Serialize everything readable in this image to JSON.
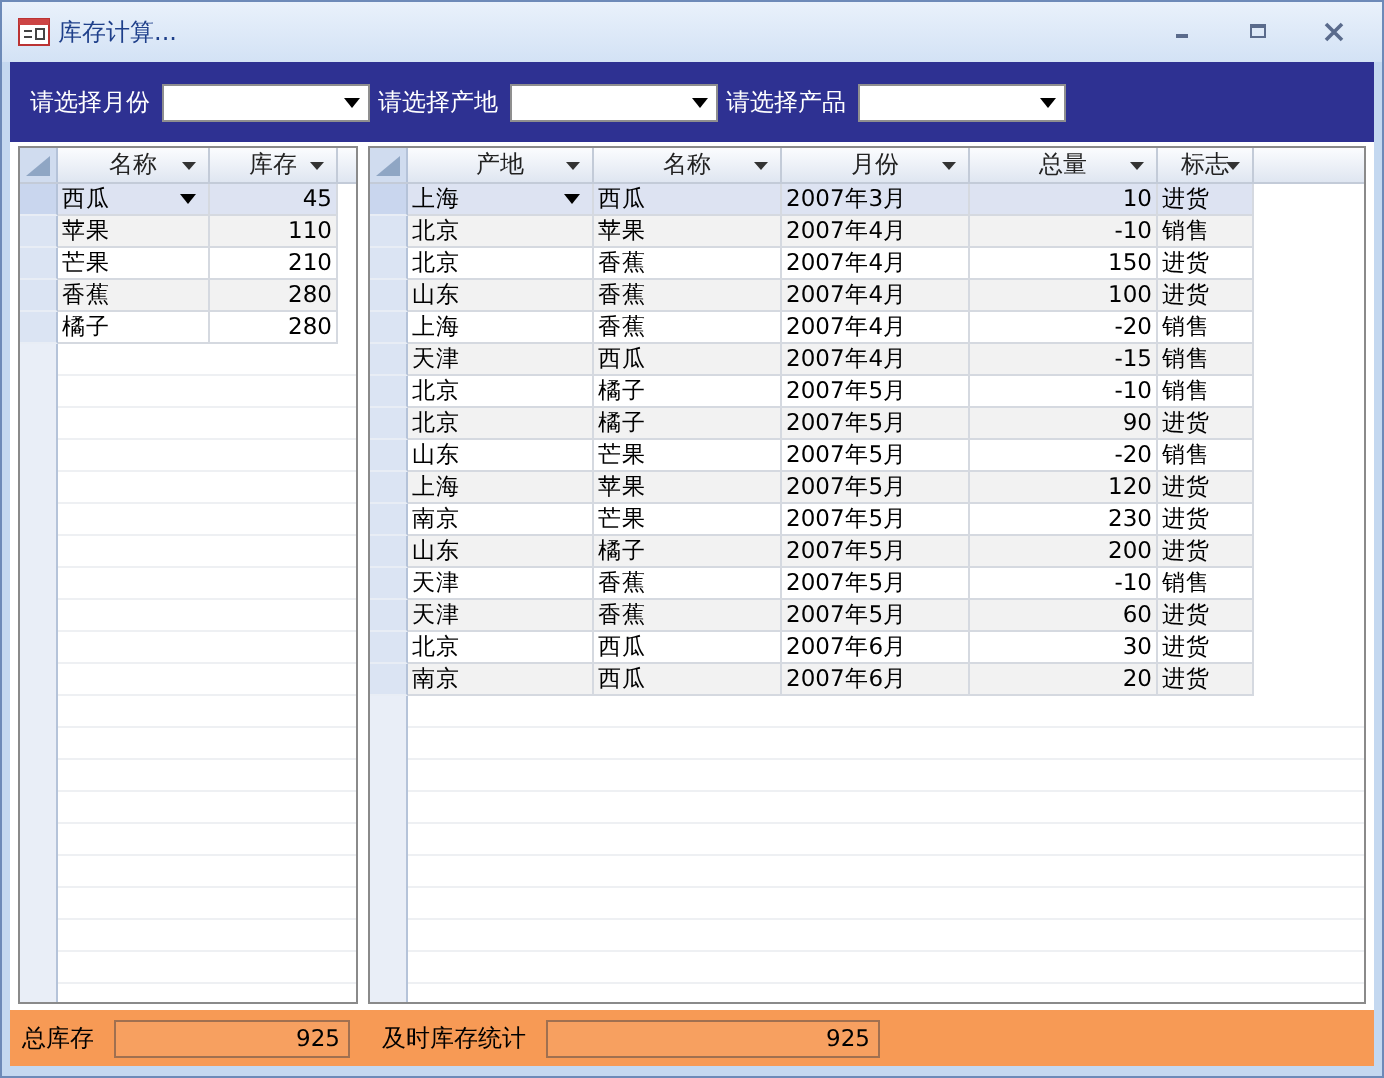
{
  "window": {
    "title": "库存计算..."
  },
  "filters": [
    {
      "label": "请选择月份"
    },
    {
      "label": "请选择产地"
    },
    {
      "label": "请选择产品"
    }
  ],
  "stock_grid": {
    "columns": [
      {
        "label": "名称",
        "kind": "text"
      },
      {
        "label": "库存",
        "kind": "number"
      }
    ],
    "rows": [
      {
        "cells": [
          "西瓜",
          "45"
        ],
        "current": true
      },
      {
        "cells": [
          "苹果",
          "110"
        ],
        "current": false
      },
      {
        "cells": [
          "芒果",
          "210"
        ],
        "current": false
      },
      {
        "cells": [
          "香蕉",
          "280"
        ],
        "current": false
      },
      {
        "cells": [
          "橘子",
          "280"
        ],
        "current": false
      }
    ]
  },
  "records_grid": {
    "columns": [
      {
        "label": "产地",
        "kind": "text"
      },
      {
        "label": "名称",
        "kind": "text"
      },
      {
        "label": "月份",
        "kind": "text"
      },
      {
        "label": "总量",
        "kind": "number"
      },
      {
        "label": "标志",
        "kind": "text"
      }
    ],
    "rows": [
      {
        "cells": [
          "上海",
          "西瓜",
          "2007年3月",
          "10",
          "进货"
        ],
        "current": true
      },
      {
        "cells": [
          "北京",
          "苹果",
          "2007年4月",
          "-10",
          "销售"
        ],
        "current": false
      },
      {
        "cells": [
          "北京",
          "香蕉",
          "2007年4月",
          "150",
          "进货"
        ],
        "current": false
      },
      {
        "cells": [
          "山东",
          "香蕉",
          "2007年4月",
          "100",
          "进货"
        ],
        "current": false
      },
      {
        "cells": [
          "上海",
          "香蕉",
          "2007年4月",
          "-20",
          "销售"
        ],
        "current": false
      },
      {
        "cells": [
          "天津",
          "西瓜",
          "2007年4月",
          "-15",
          "销售"
        ],
        "current": false
      },
      {
        "cells": [
          "北京",
          "橘子",
          "2007年5月",
          "-10",
          "销售"
        ],
        "current": false
      },
      {
        "cells": [
          "北京",
          "橘子",
          "2007年5月",
          "90",
          "进货"
        ],
        "current": false
      },
      {
        "cells": [
          "山东",
          "芒果",
          "2007年5月",
          "-20",
          "销售"
        ],
        "current": false
      },
      {
        "cells": [
          "上海",
          "苹果",
          "2007年5月",
          "120",
          "进货"
        ],
        "current": false
      },
      {
        "cells": [
          "南京",
          "芒果",
          "2007年5月",
          "230",
          "进货"
        ],
        "current": false
      },
      {
        "cells": [
          "山东",
          "橘子",
          "2007年5月",
          "200",
          "进货"
        ],
        "current": false
      },
      {
        "cells": [
          "天津",
          "香蕉",
          "2007年5月",
          "-10",
          "销售"
        ],
        "current": false
      },
      {
        "cells": [
          "天津",
          "香蕉",
          "2007年5月",
          "60",
          "进货"
        ],
        "current": false
      },
      {
        "cells": [
          "北京",
          "西瓜",
          "2007年6月",
          "30",
          "进货"
        ],
        "current": false
      },
      {
        "cells": [
          "南京",
          "西瓜",
          "2007年6月",
          "20",
          "进货"
        ],
        "current": false
      }
    ]
  },
  "footer": {
    "fields": [
      {
        "label": "总库存",
        "value": "925"
      },
      {
        "label": "及时库存统计",
        "value": "925"
      }
    ]
  }
}
